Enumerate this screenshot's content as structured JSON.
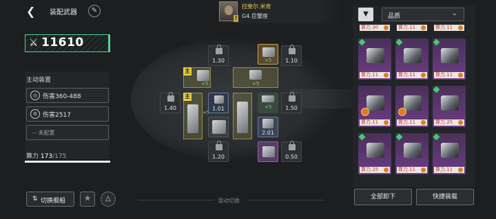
{
  "header": {
    "back_icon": "chevron-left-icon",
    "title": "装配武器",
    "edit_icon": "edit-icon"
  },
  "power": {
    "icon": "swords-icon",
    "value": "11610"
  },
  "active_equipment": {
    "label": "主动装置",
    "items": [
      {
        "icon": "target-icon",
        "text": "伤害360-488"
      },
      {
        "icon": "gear-icon",
        "text": "伤害2517"
      },
      {
        "icon": "",
        "text": "-- 未配置"
      }
    ]
  },
  "capacity": {
    "label": "算力",
    "used": "173",
    "sep": "/",
    "total": "175",
    "fraction": 0.99
  },
  "bottom": {
    "switch_label": "切换舰船",
    "btn2_icon": "fleet-icon",
    "btn3_icon": "compass-icon",
    "swipe_label": "滑动切换"
  },
  "pilot": {
    "name": "拉斐尔.米奇",
    "ship": "G4.巨蟹座",
    "level": "7"
  },
  "slots": {
    "locked_values": [
      "1.30",
      "1.10",
      "1.40",
      "1.50",
      "1.20",
      "0.50"
    ],
    "equipped_values": [
      "1.01",
      "2.01"
    ],
    "plus_labels": [
      "+5",
      "+5",
      "+5",
      "+5",
      "+5"
    ],
    "main_mark": "主"
  },
  "right_panel": {
    "filter_icon": "filter-icon",
    "sort_label": "品质",
    "sort_chevron": "⌄",
    "top_tags": [
      "算力.30",
      "算力.11",
      "算力.11"
    ],
    "cards": [
      {
        "tag": "算力.11"
      },
      {
        "tag": "算力.11"
      },
      {
        "tag": "算力.11"
      },
      {
        "tag": "算力.11"
      },
      {
        "tag": "算力.11"
      },
      {
        "tag": "算力.25"
      },
      {
        "tag": "算力.25"
      },
      {
        "tag": "算力.11"
      },
      {
        "tag": "算力.11"
      }
    ],
    "unequip_all": "全部卸下",
    "quick_equip": "快捷装载"
  }
}
